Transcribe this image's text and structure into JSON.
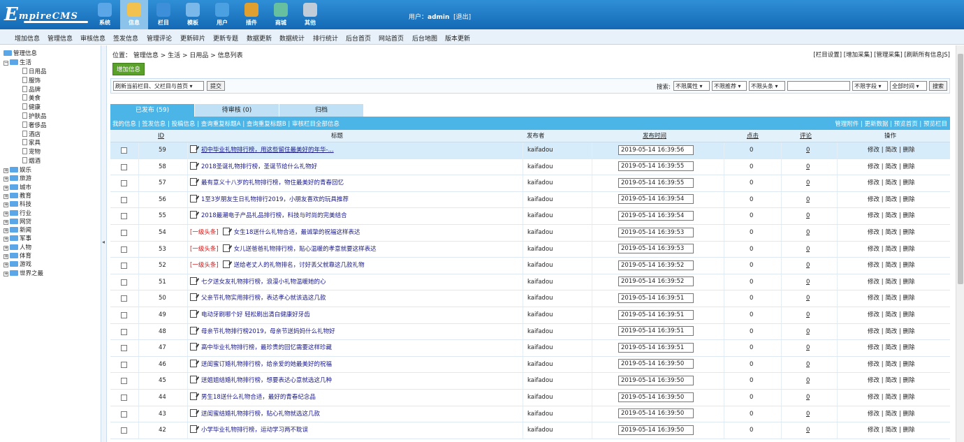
{
  "brand": {
    "logo_big": "E",
    "logo_rest": "mpireCMS"
  },
  "topnav": [
    {
      "label": "系统",
      "icon": "globe-icon",
      "color": "#5aa6e6"
    },
    {
      "label": "信息",
      "icon": "document-edit-icon",
      "color": "#f2c14e"
    },
    {
      "label": "栏目",
      "icon": "folder-icon",
      "color": "#3d8fd9"
    },
    {
      "label": "模板",
      "icon": "window-icon",
      "color": "#7ab8ea"
    },
    {
      "label": "用户",
      "icon": "user-icon",
      "color": "#4aa0e0"
    },
    {
      "label": "插件",
      "icon": "tools-icon",
      "color": "#e0a030"
    },
    {
      "label": "商城",
      "icon": "shop-icon",
      "color": "#66c0a0"
    },
    {
      "label": "其他",
      "icon": "gear-icon",
      "color": "#c0ccd8"
    }
  ],
  "user": {
    "prefix": "用户：",
    "name": "admin",
    "logout": "[退出]"
  },
  "menu": [
    "增加信息",
    "管理信息",
    "审核信息",
    "签发信息",
    "管理评论",
    "更新碎片",
    "更新专题",
    "数据更新",
    "数据统计",
    "排行统计",
    "后台首页",
    "网站首页",
    "后台地图",
    "版本更新"
  ],
  "sidebar": {
    "root": "管理信息",
    "expanded": "生活",
    "children": [
      "日用品",
      "服饰",
      "品牌",
      "美食",
      "健康",
      "护肤品",
      "奢侈品",
      "酒店",
      "家具",
      "宠物",
      "烟酒"
    ],
    "collapsed": [
      "娱乐",
      "旅游",
      "城市",
      "教育",
      "科技",
      "行业",
      "网贷",
      "新闻",
      "军事",
      "人物",
      "体育",
      "游戏",
      "世界之最"
    ]
  },
  "breadcrumb": "位置： 管理信息 > 生活 > 日用品 > 信息列表",
  "top_links": "[栏目设置] [增加采集] [管理采集] [刷新所有信息JS]",
  "add_button": "增加信息",
  "toolbar": {
    "refresh_select": "刷新当前栏目、父栏目与首页",
    "submit": "提交",
    "search_label": "搜索:",
    "filters": [
      "不限属性",
      "不限推荐",
      "不限头条"
    ],
    "search_value": "",
    "field": "不限字段",
    "time": "全部时间",
    "search_button": "搜索"
  },
  "tabs": [
    "已发布 (59)",
    "待审核 (0)",
    "归档"
  ],
  "links_left": "我的信息 | 签发信息 | 投稿信息 | 查询重复标题A | 查询重复标题B | 审核栏目全部信息",
  "links_right": "管理附件 | 更新数据 | 预览首页 | 预览栏目",
  "columns": {
    "id": "ID",
    "title": "标题",
    "author": "发布者",
    "time": "发布时间",
    "clicks": "点击",
    "comments": "评论",
    "ops": "操作"
  },
  "ops": "修改 | 简改 | 删除",
  "toutiao_label": "[一级头条]",
  "rows": [
    {
      "id": "59",
      "title": "初中毕业礼物排行榜，用这些留住最美好的年华-...",
      "author": "kaifadou",
      "time": "2019-05-14 16:39:56",
      "clicks": "0",
      "comments": "0",
      "toutiao": false,
      "highlight": true
    },
    {
      "id": "58",
      "title": "2018圣诞礼物排行榜，圣诞节给什么礼物好",
      "author": "kaifadou",
      "time": "2019-05-14 16:39:55",
      "clicks": "0",
      "comments": "0",
      "toutiao": false,
      "highlight": false
    },
    {
      "id": "57",
      "title": "最有意义十八岁的礼物排行榜，物住最美好的青春回忆",
      "author": "kaifadou",
      "time": "2019-05-14 16:39:55",
      "clicks": "0",
      "comments": "0",
      "toutiao": false,
      "highlight": false
    },
    {
      "id": "56",
      "title": "1至3岁朋友生日礼物排行2019，小朋友喜欢的玩具推荐",
      "author": "kaifadou",
      "time": "2019-05-14 16:39:54",
      "clicks": "0",
      "comments": "0",
      "toutiao": false,
      "highlight": false
    },
    {
      "id": "55",
      "title": "2018最潮电子产品礼品排行榜，科技与时尚的完美结合",
      "author": "kaifadou",
      "time": "2019-05-14 16:39:54",
      "clicks": "0",
      "comments": "0",
      "toutiao": false,
      "highlight": false
    },
    {
      "id": "54",
      "title": "女生18送什么礼物合适，最诚挚的祝福这样表达",
      "author": "kaifadou",
      "time": "2019-05-14 16:39:53",
      "clicks": "0",
      "comments": "0",
      "toutiao": true,
      "highlight": false
    },
    {
      "id": "53",
      "title": "女儿送爸爸礼物排行榜，贴心温暖的孝意就要这样表达",
      "author": "kaifadou",
      "time": "2019-05-14 16:39:53",
      "clicks": "0",
      "comments": "0",
      "toutiao": true,
      "highlight": false
    },
    {
      "id": "52",
      "title": "送给老丈人的礼物排名，讨好丢父就靠这几款礼物",
      "author": "kaifadou",
      "time": "2019-05-14 16:39:52",
      "clicks": "0",
      "comments": "0",
      "toutiao": true,
      "highlight": false
    },
    {
      "id": "51",
      "title": "七夕送女友礼物排行榜，浪漫小礼物温暖她的心",
      "author": "kaifadou",
      "time": "2019-05-14 16:39:52",
      "clicks": "0",
      "comments": "0",
      "toutiao": false,
      "highlight": false
    },
    {
      "id": "50",
      "title": "父亲节礼物实用排行榜，表达孝心就该选这几款",
      "author": "kaifadou",
      "time": "2019-05-14 16:39:51",
      "clicks": "0",
      "comments": "0",
      "toutiao": false,
      "highlight": false
    },
    {
      "id": "49",
      "title": "电动牙刷哪个好 轻松刷出清白健康好牙齿",
      "author": "kaifadou",
      "time": "2019-05-14 16:39:51",
      "clicks": "0",
      "comments": "0",
      "toutiao": false,
      "highlight": false
    },
    {
      "id": "48",
      "title": "母亲节礼物排行榜2019，母亲节送妈妈什么礼物好",
      "author": "kaifadou",
      "time": "2019-05-14 16:39:51",
      "clicks": "0",
      "comments": "0",
      "toutiao": false,
      "highlight": false
    },
    {
      "id": "47",
      "title": "高中毕业礼物排行榜，最珍贵的回忆需要这样珍藏",
      "author": "kaifadou",
      "time": "2019-05-14 16:39:51",
      "clicks": "0",
      "comments": "0",
      "toutiao": false,
      "highlight": false
    },
    {
      "id": "46",
      "title": "送闺蜜订婚礼物排行榜，给亲爱的她最美好的祝福",
      "author": "kaifadou",
      "time": "2019-05-14 16:39:50",
      "clicks": "0",
      "comments": "0",
      "toutiao": false,
      "highlight": false
    },
    {
      "id": "45",
      "title": "送姐姐结婚礼物排行榜，想要表达心意就选这几种",
      "author": "kaifadou",
      "time": "2019-05-14 16:39:50",
      "clicks": "0",
      "comments": "0",
      "toutiao": false,
      "highlight": false
    },
    {
      "id": "44",
      "title": "男生18送什么礼物合适，最好的青春纪念品",
      "author": "kaifadou",
      "time": "2019-05-14 16:39:50",
      "clicks": "0",
      "comments": "0",
      "toutiao": false,
      "highlight": false
    },
    {
      "id": "43",
      "title": "送闺蜜结婚礼物排行榜，贴心礼物就选这几款",
      "author": "kaifadou",
      "time": "2019-05-14 16:39:50",
      "clicks": "0",
      "comments": "0",
      "toutiao": false,
      "highlight": false
    },
    {
      "id": "42",
      "title": "小学毕业礼物排行榜，运动学习两不耽误",
      "author": "kaifadou",
      "time": "2019-05-14 16:39:50",
      "clicks": "0",
      "comments": "0",
      "toutiao": false,
      "highlight": false
    }
  ]
}
